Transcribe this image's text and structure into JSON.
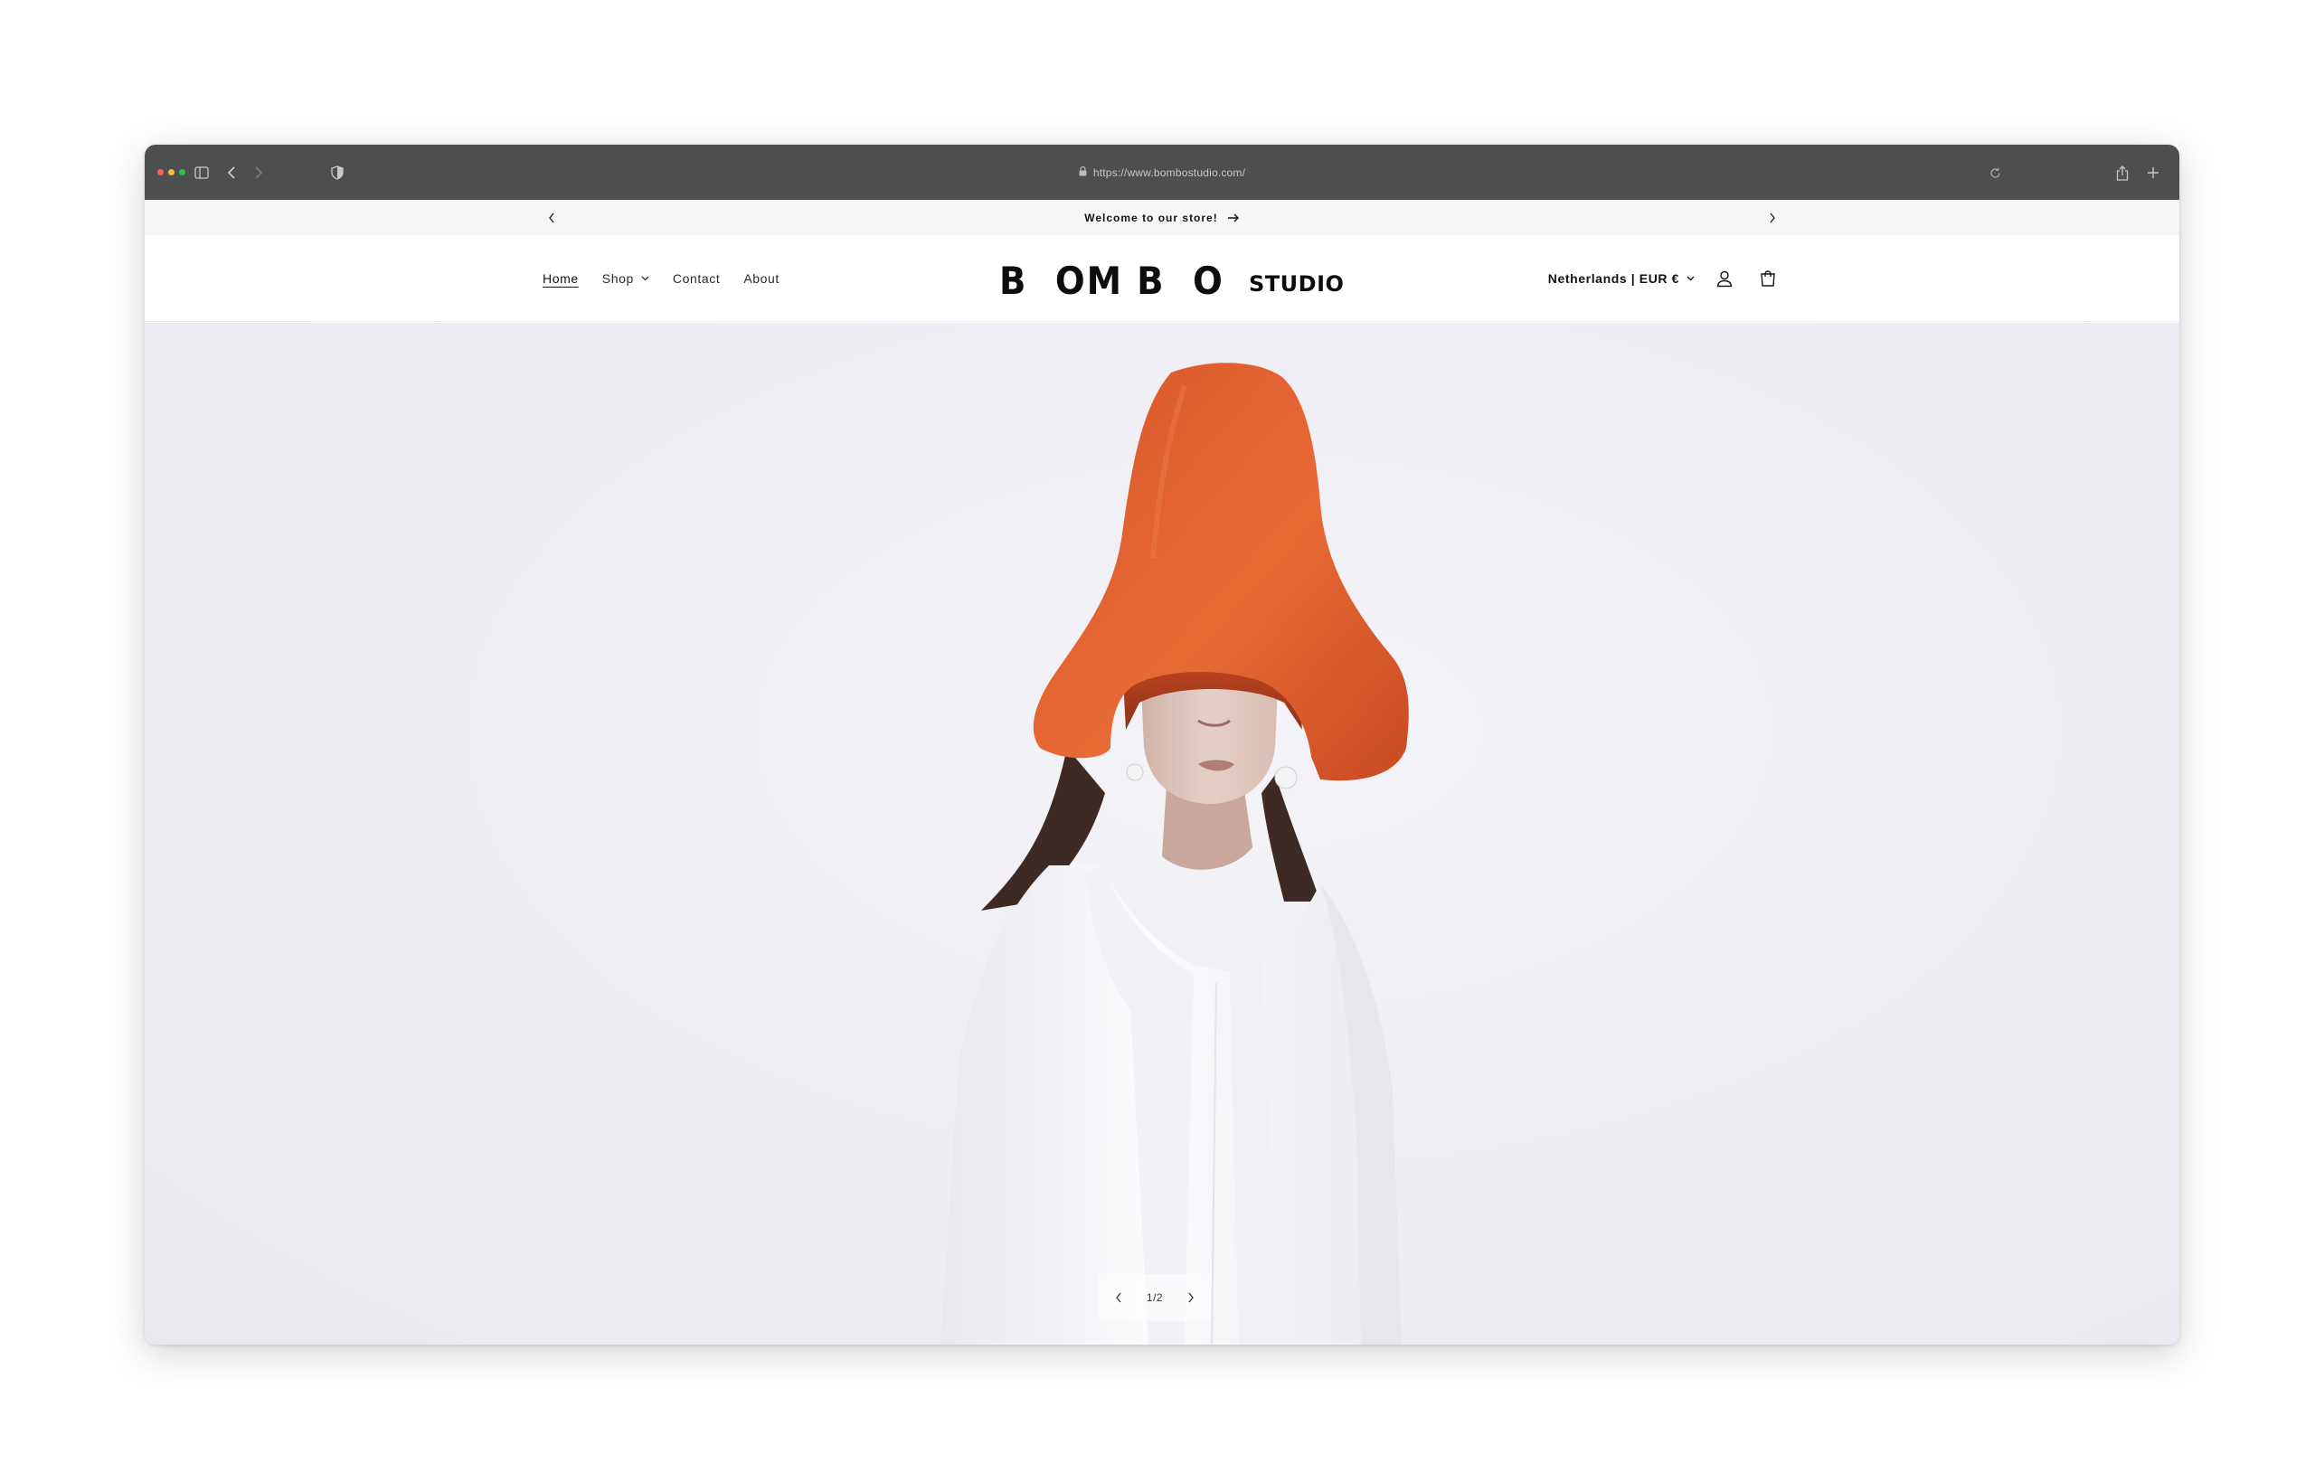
{
  "browser": {
    "url": "https://www.bombostudio.com/"
  },
  "announcement": {
    "text": "Welcome to our store!"
  },
  "nav": {
    "items": [
      {
        "label": "Home"
      },
      {
        "label": "Shop"
      },
      {
        "label": "Contact"
      },
      {
        "label": "About"
      }
    ]
  },
  "logo": {
    "main": "B  OM B  O",
    "sub": "STUDIO"
  },
  "header": {
    "locale": "Netherlands | EUR €"
  },
  "slider": {
    "counter": "1/2"
  },
  "icons": {
    "sidebar": "sidebar-icon",
    "back": "chevron-left-icon",
    "forward": "chevron-right-icon",
    "shield": "shield-icon",
    "lock": "lock-icon",
    "reload": "reload-icon",
    "share": "share-icon",
    "new_tab": "plus-icon",
    "account": "account-icon",
    "cart": "cart-icon"
  },
  "colors": {
    "chrome": "#4d4e50",
    "announcement_bg": "#f6f6f7",
    "hat": "#e4622c",
    "text": "#121212"
  }
}
